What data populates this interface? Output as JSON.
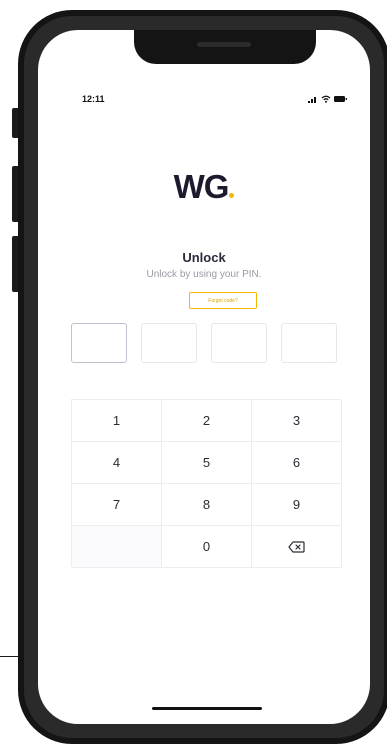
{
  "status_bar": {
    "time": "12:11"
  },
  "brand": {
    "logo_text": "WG",
    "accent_color": "#f2b705",
    "text_color": "#1c1b2e"
  },
  "unlock": {
    "title": "Unlock",
    "subtitle": "Unlock by using your PIN.",
    "forgot_label": "Forgot code?"
  },
  "pin": {
    "length": 4,
    "entered": 0
  },
  "keypad": {
    "keys": [
      "1",
      "2",
      "3",
      "4",
      "5",
      "6",
      "7",
      "8",
      "9",
      "",
      "0",
      "backspace-icon"
    ]
  }
}
